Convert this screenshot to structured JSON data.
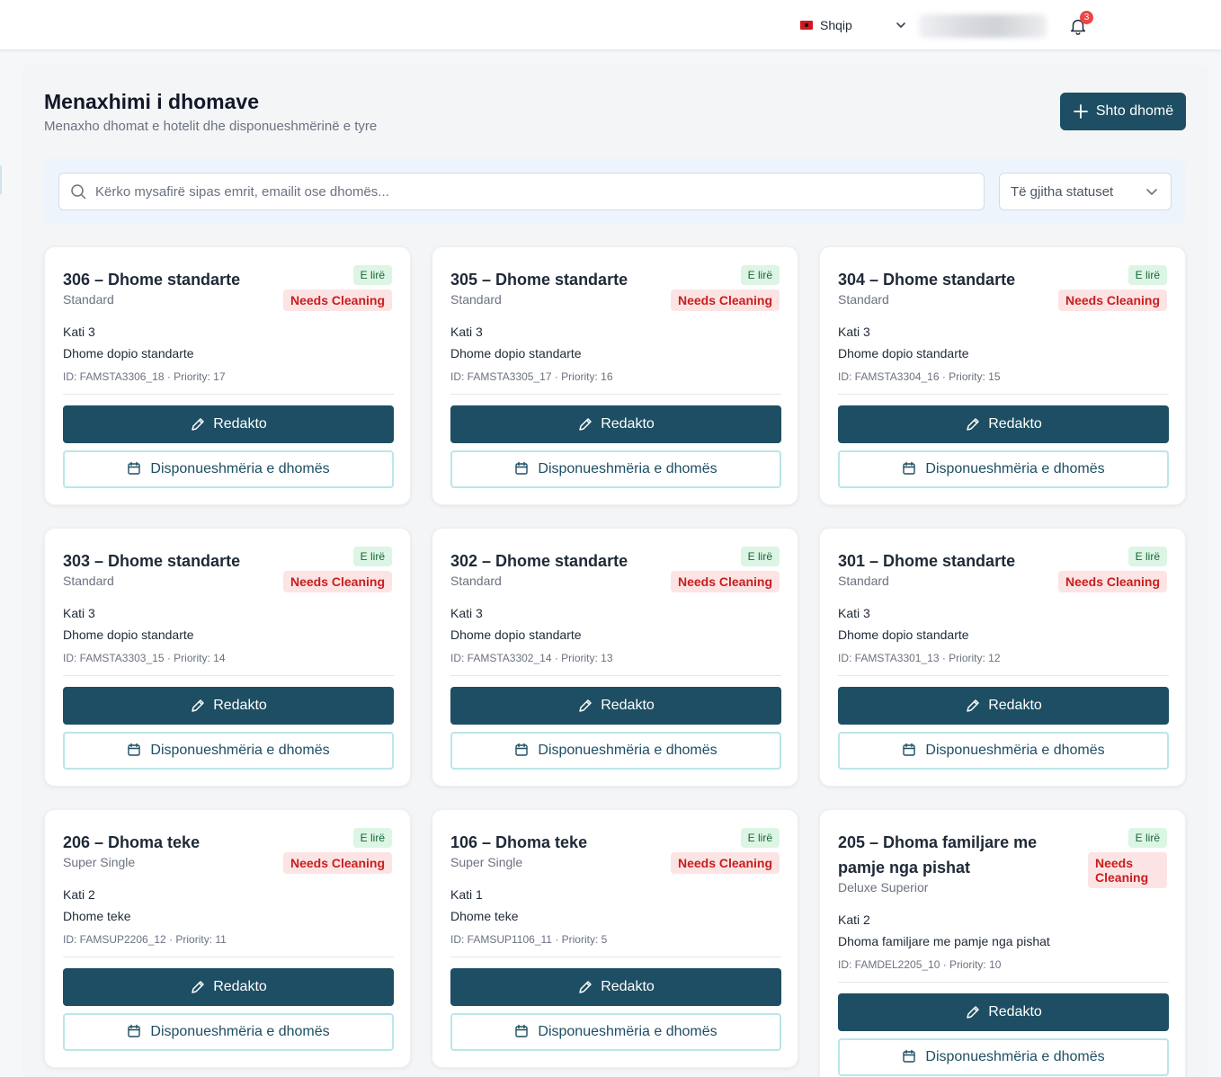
{
  "header": {
    "language": "Shqip",
    "notifications_count": "3"
  },
  "page": {
    "title": "Menaxhimi i dhomave",
    "subtitle": "Menaxho dhomat e hotelit dhe disponueshmërinë e tyre",
    "add_button": "Shto dhomë"
  },
  "filters": {
    "search_placeholder": "Kërko mysafirë sipas emrit, emailit ose dhomës...",
    "status_selected": "Të gjitha statuset"
  },
  "labels": {
    "edit": "Redakto",
    "availability": "Disponueshmëria e dhomës"
  },
  "colors": {
    "primary": "#1d4e63",
    "free_badge_bg": "#dcf5e4",
    "cleaning_badge_bg": "#fde4e4",
    "cleaning_badge_text": "#c81e1e"
  },
  "rooms": [
    {
      "title": "306 – Dhome standarte",
      "type": "Standard",
      "status": "E lirë",
      "cleaning": "Needs Cleaning",
      "floor": "Kati 3",
      "description": "Dhome dopio standarte",
      "meta": "ID: FAMSTA3306_18 · Priority: 17"
    },
    {
      "title": "305 – Dhome standarte",
      "type": "Standard",
      "status": "E lirë",
      "cleaning": "Needs Cleaning",
      "floor": "Kati 3",
      "description": "Dhome dopio standarte",
      "meta": "ID: FAMSTA3305_17 · Priority: 16"
    },
    {
      "title": "304 – Dhome standarte",
      "type": "Standard",
      "status": "E lirë",
      "cleaning": "Needs Cleaning",
      "floor": "Kati 3",
      "description": "Dhome dopio standarte",
      "meta": "ID: FAMSTA3304_16 · Priority: 15"
    },
    {
      "title": "303 – Dhome standarte",
      "type": "Standard",
      "status": "E lirë",
      "cleaning": "Needs Cleaning",
      "floor": "Kati 3",
      "description": "Dhome dopio standarte",
      "meta": "ID: FAMSTA3303_15 · Priority: 14"
    },
    {
      "title": "302 – Dhome standarte",
      "type": "Standard",
      "status": "E lirë",
      "cleaning": "Needs Cleaning",
      "floor": "Kati 3",
      "description": "Dhome dopio standarte",
      "meta": "ID: FAMSTA3302_14 · Priority: 13"
    },
    {
      "title": "301 – Dhome standarte",
      "type": "Standard",
      "status": "E lirë",
      "cleaning": "Needs Cleaning",
      "floor": "Kati 3",
      "description": "Dhome dopio standarte",
      "meta": "ID: FAMSTA3301_13 · Priority: 12"
    },
    {
      "title": "206 – Dhoma teke",
      "type": "Super Single",
      "status": "E lirë",
      "cleaning": "Needs Cleaning",
      "floor": "Kati 2",
      "description": "Dhome teke",
      "meta": "ID: FAMSUP2206_12 · Priority: 11"
    },
    {
      "title": "106 – Dhoma teke",
      "type": "Super Single",
      "status": "E lirë",
      "cleaning": "Needs Cleaning",
      "floor": "Kati 1",
      "description": "Dhome teke",
      "meta": "ID: FAMSUP1106_11 · Priority: 5"
    },
    {
      "title": "205 – Dhoma familjare me pamje nga pishat",
      "type": "Deluxe Superior",
      "status": "E lirë",
      "cleaning": "Needs Cleaning",
      "floor": "Kati 2",
      "description": "Dhoma familjare me pamje nga pishat",
      "meta": "ID: FAMDEL2205_10 · Priority: 10"
    }
  ]
}
